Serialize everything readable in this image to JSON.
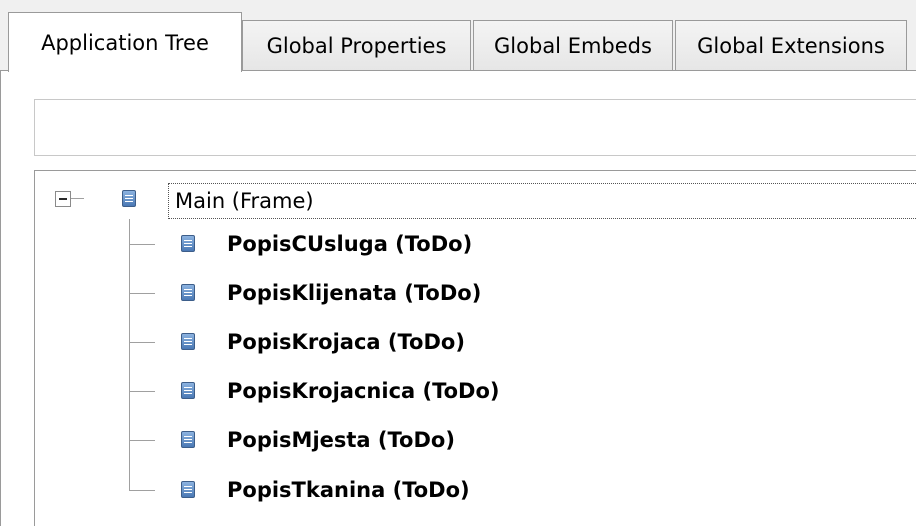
{
  "tabs": [
    {
      "label": "Application Tree",
      "active": true
    },
    {
      "label": "Global Properties",
      "active": false
    },
    {
      "label": "Global Embeds",
      "active": false
    },
    {
      "label": "Global Extensions",
      "active": false
    }
  ],
  "search": {
    "value": "",
    "placeholder": ""
  },
  "tree": {
    "root": {
      "label": "Main (Frame)",
      "icon": "procedure-icon",
      "expanded": true
    },
    "children": [
      {
        "label": "PopisCUsluga (ToDo)",
        "icon": "procedure-icon"
      },
      {
        "label": "PopisKlijenata (ToDo)",
        "icon": "procedure-icon"
      },
      {
        "label": "PopisKrojaca (ToDo)",
        "icon": "procedure-icon"
      },
      {
        "label": "PopisKrojacnica (ToDo)",
        "icon": "procedure-icon"
      },
      {
        "label": "PopisMjesta (ToDo)",
        "icon": "procedure-icon"
      },
      {
        "label": "PopisTkanina (ToDo)",
        "icon": "procedure-icon"
      }
    ]
  },
  "colors": {
    "icon_fill": "#4a78b4",
    "border": "#9a9a9a",
    "background": "#f0f0f0"
  }
}
